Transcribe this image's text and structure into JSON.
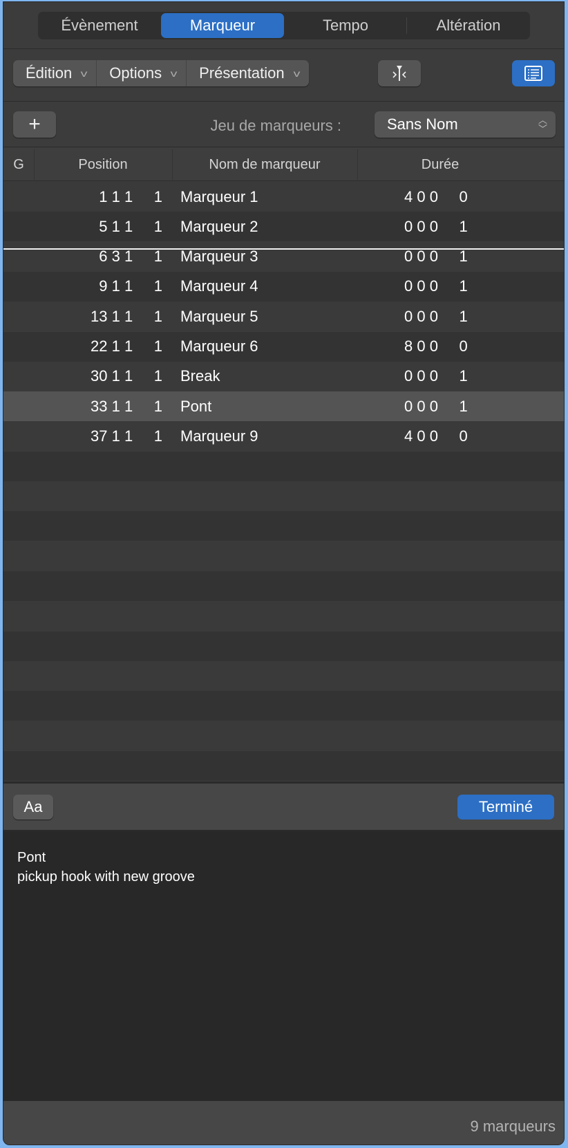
{
  "tabs": [
    {
      "label": "Évènement",
      "active": false
    },
    {
      "label": "Marqueur",
      "active": true
    },
    {
      "label": "Tempo",
      "active": false
    },
    {
      "label": "Altération",
      "active": false
    }
  ],
  "toolbar": {
    "menus": [
      "Édition",
      "Options",
      "Présentation"
    ],
    "catch_icon": "catch-playhead-icon",
    "list_icon": "list-view-icon"
  },
  "marker_set": {
    "add_label": "+",
    "label": "Jeu de marqueurs :",
    "selected": "Sans Nom"
  },
  "table": {
    "columns": [
      "G",
      "Position",
      "Nom de marqueur",
      "Durée"
    ],
    "rows": [
      {
        "position": "1 1 1     1",
        "name": "Marqueur 1",
        "duration": "4 0 0     0"
      },
      {
        "position": "5 1 1     1",
        "name": "Marqueur 2",
        "duration": "0 0 0     1"
      },
      {
        "position": "6 3 1     1",
        "name": "Marqueur 3",
        "duration": "0 0 0     1"
      },
      {
        "position": "9 1 1     1",
        "name": "Marqueur 4",
        "duration": "0 0 0     1"
      },
      {
        "position": "13 1 1     1",
        "name": "Marqueur 5",
        "duration": "0 0 0     1"
      },
      {
        "position": "22 1 1     1",
        "name": "Marqueur 6",
        "duration": "8 0 0     0"
      },
      {
        "position": "30 1 1     1",
        "name": "Break",
        "duration": "0 0 0     1"
      },
      {
        "position": "33 1 1     1",
        "name": "Pont",
        "duration": "0 0 0     1",
        "selected": true
      },
      {
        "position": "37 1 1     1",
        "name": "Marqueur 9",
        "duration": "4 0 0     0"
      }
    ]
  },
  "notes": {
    "font_button": "Aa",
    "done_button": "Terminé",
    "lines": [
      "Pont",
      "pickup hook with new groove"
    ]
  },
  "footer": {
    "count": "9 marqueurs"
  },
  "colors": {
    "accent": "#2c6fc5",
    "background": "#3c3c3c",
    "selected_row": "#545454"
  }
}
